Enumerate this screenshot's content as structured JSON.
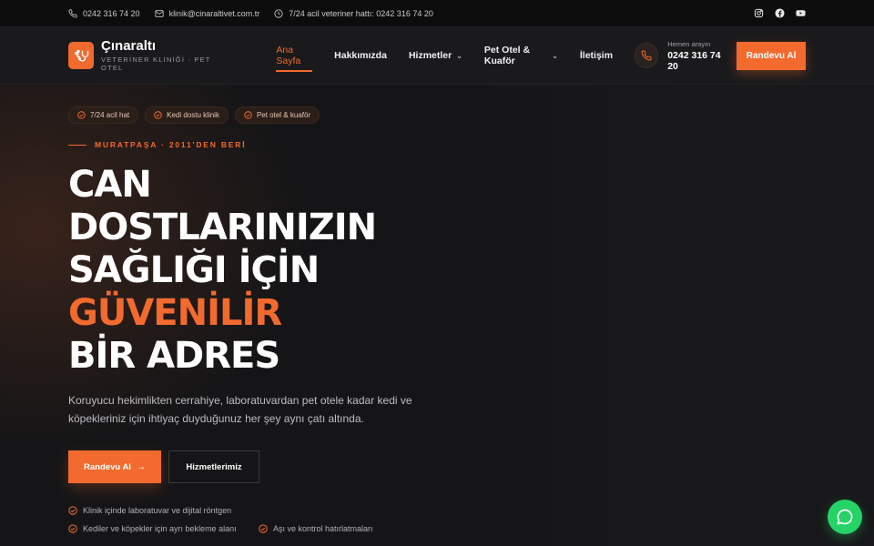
{
  "topbar": {
    "phone": "0242 316 74 20",
    "email": "klinik@cinaraltivet.com.tr",
    "emergency": "7/24 acil veteriner hattı: 0242 316 74 20"
  },
  "brand": {
    "name": "Çınaraltı",
    "subtitle": "VETERİNER KLİNİĞİ · PET OTEL"
  },
  "nav": {
    "items": [
      {
        "label": "Ana Sayfa",
        "active": true
      },
      {
        "label": "Hakkımızda"
      },
      {
        "label": "Hizmetler",
        "dropdown": true
      },
      {
        "label": "Pet Otel & Kuaför",
        "dropdown": true
      },
      {
        "label": "İletişim"
      }
    ]
  },
  "call": {
    "label": "Hemen arayın",
    "phone": "0242 316 74 20"
  },
  "header_cta": "Randevu Al",
  "hero": {
    "pills": [
      "7/24 acil hat",
      "Kedi dostu klinik",
      "Pet otel & kuaför"
    ],
    "eyebrow": "MURATPAŞA · 2011'DEN BERİ",
    "headline": [
      "CAN",
      "DOSTLARINIZIN",
      "SAĞLIĞI İÇİN",
      "GÜVENİLİR",
      "BİR ADRES"
    ],
    "description": "Koruyucu hekimlikten cerrahiye, laboratuvardan pet otele kadar kedi ve köpekleriniz için ihtiyaç duyduğunuz her şey aynı çatı altında.",
    "primary_button": "Randevu Al",
    "secondary_button": "Hizmetlerimiz",
    "features": [
      "Klinik içinde laboratuvar ve dijital röntgen",
      "Kediler ve köpekler için ayrı bekleme alanı",
      "Aşı ve kontrol hatırlatmaları"
    ]
  },
  "colors": {
    "accent": "#f26a2e",
    "background": "#141416",
    "whatsapp": "#25d366"
  }
}
